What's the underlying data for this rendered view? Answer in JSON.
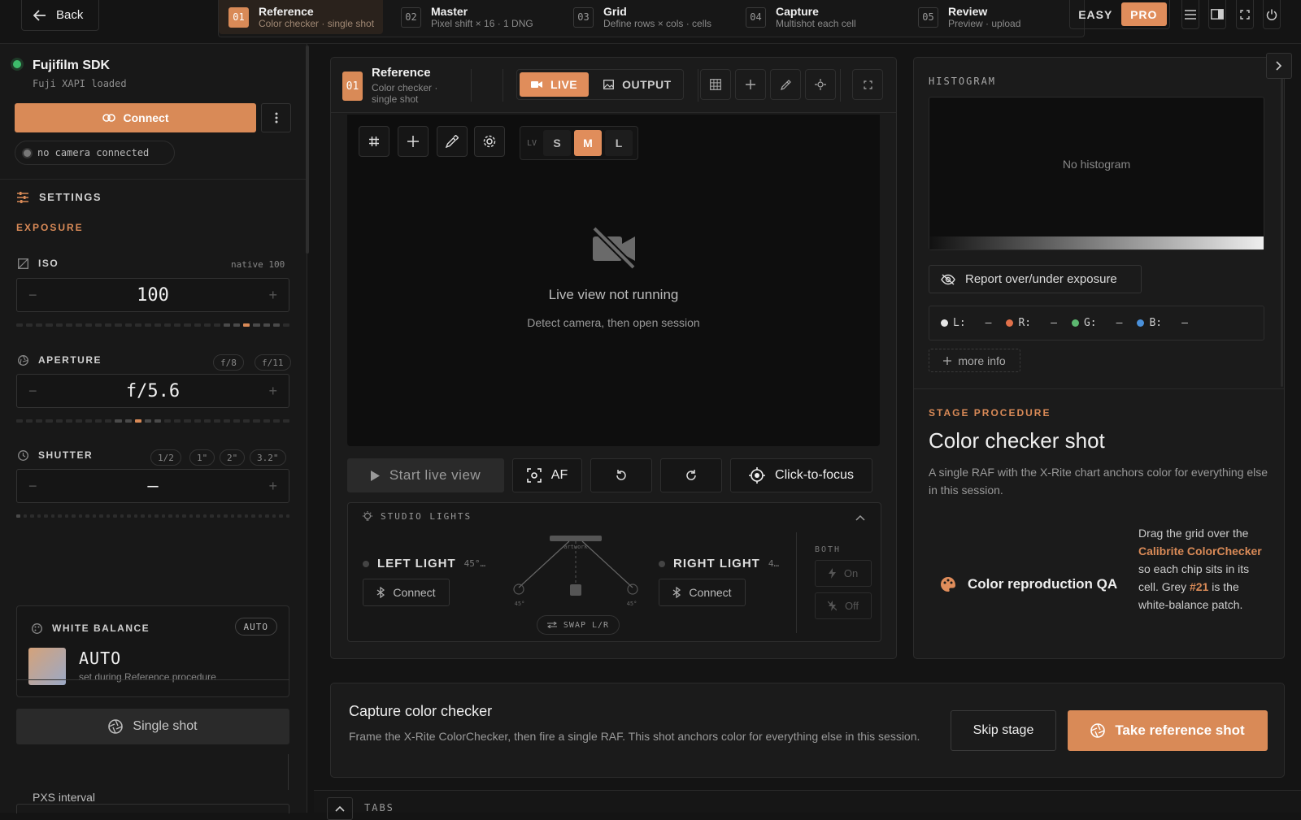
{
  "topbar": {
    "back_label": "Back",
    "steps": [
      {
        "num": "01",
        "title": "Reference",
        "sub": "Color checker · single shot",
        "active": true
      },
      {
        "num": "02",
        "title": "Master",
        "sub": "Pixel shift × 16 · 1 DNG"
      },
      {
        "num": "03",
        "title": "Grid",
        "sub": "Define rows × cols · cells"
      },
      {
        "num": "04",
        "title": "Capture",
        "sub": "Multishot each cell"
      },
      {
        "num": "05",
        "title": "Review",
        "sub": "Preview · upload"
      }
    ],
    "mode_easy": "EASY",
    "mode_pro": "PRO",
    "mode_selected": "PRO"
  },
  "sidebar": {
    "sdk_name": "Fujifilm SDK",
    "sdk_status": "Fuji XAPI loaded",
    "connect_label": "Connect",
    "camera_status": "no camera connected",
    "settings_label": "SETTINGS",
    "exposure_label": "EXPOSURE",
    "iso": {
      "label": "ISO",
      "hint": "native 100",
      "value": "100",
      "minus": "−",
      "plus": "+"
    },
    "aperture": {
      "label": "APERTURE",
      "chips": [
        "f/8",
        "f/11"
      ],
      "value": "f/5.6",
      "minus": "−",
      "plus": "+"
    },
    "shutter": {
      "label": "SHUTTER",
      "chips": [
        "1/2",
        "1\"",
        "2\"",
        "3.2\""
      ],
      "value": "—",
      "minus": "−",
      "plus": "+"
    },
    "white_balance": {
      "label": "WHITE BALANCE",
      "badge": "AUTO",
      "value": "AUTO",
      "sub": "set during Reference procedure"
    },
    "single_shot_label": "Single shot",
    "pxs_interval_label": "PXS interval"
  },
  "center": {
    "stage_num": "01",
    "stage_title": "Reference",
    "stage_sub": "Color checker · single shot",
    "live_label": "LIVE",
    "output_label": "OUTPUT",
    "view_selected": "LIVE",
    "lv_label": "LV",
    "lv_sizes": [
      "S",
      "M",
      "L"
    ],
    "lv_selected": "M",
    "live_msg": "Live view not running",
    "live_hint": "Detect camera, then open session",
    "start_live_label": "Start live view",
    "af_label": "AF",
    "click_focus_label": "Click-to-focus",
    "studio_lights_label": "STUDIO LIGHTS",
    "left_light": {
      "name": "LEFT LIGHT",
      "angle": "45°…",
      "connect": "Connect"
    },
    "right_light": {
      "name": "RIGHT LIGHT",
      "angle": "4…",
      "connect": "Connect"
    },
    "diagram_artwork": "artwork",
    "diagram_angle_left": "45°",
    "diagram_angle_right": "45°",
    "swap_label": "SWAP L/R",
    "both_label": "BOTH",
    "on_label": "On",
    "off_label": "Off"
  },
  "right": {
    "histogram_label": "HISTOGRAM",
    "no_histogram": "No histogram",
    "report_label": "Report over/under exposure",
    "channels": [
      {
        "label": "L:",
        "value": "—",
        "color": "#e6e6e6"
      },
      {
        "label": "R:",
        "value": "—",
        "color": "#e0704a"
      },
      {
        "label": "G:",
        "value": "—",
        "color": "#5cb870"
      },
      {
        "label": "B:",
        "value": "—",
        "color": "#4a90d9"
      }
    ],
    "more_info_label": "more info",
    "stage_procedure_label": "STAGE PROCEDURE",
    "procedure_title": "Color checker shot",
    "procedure_desc": "A single RAF with the X-Rite chart anchors color for everything else in this session.",
    "qa_title": "Color reproduction QA",
    "qa_text_1": "Drag the grid over the ",
    "qa_highlight_1": "Calibrite ColorChecker",
    "qa_text_2": " so each chip sits in its cell. Grey ",
    "qa_highlight_2": "#21",
    "qa_text_3": " is the white-balance patch."
  },
  "bottom": {
    "title": "Capture color checker",
    "desc": "Frame the X-Rite ColorChecker, then fire a single RAF. This shot anchors color for everything else in this session.",
    "skip_label": "Skip stage",
    "take_label": "Take reference shot",
    "tabs_label": "TABS"
  },
  "colors": {
    "accent": "#d98a57",
    "background": "#141414",
    "panel": "#1b1b1b"
  }
}
